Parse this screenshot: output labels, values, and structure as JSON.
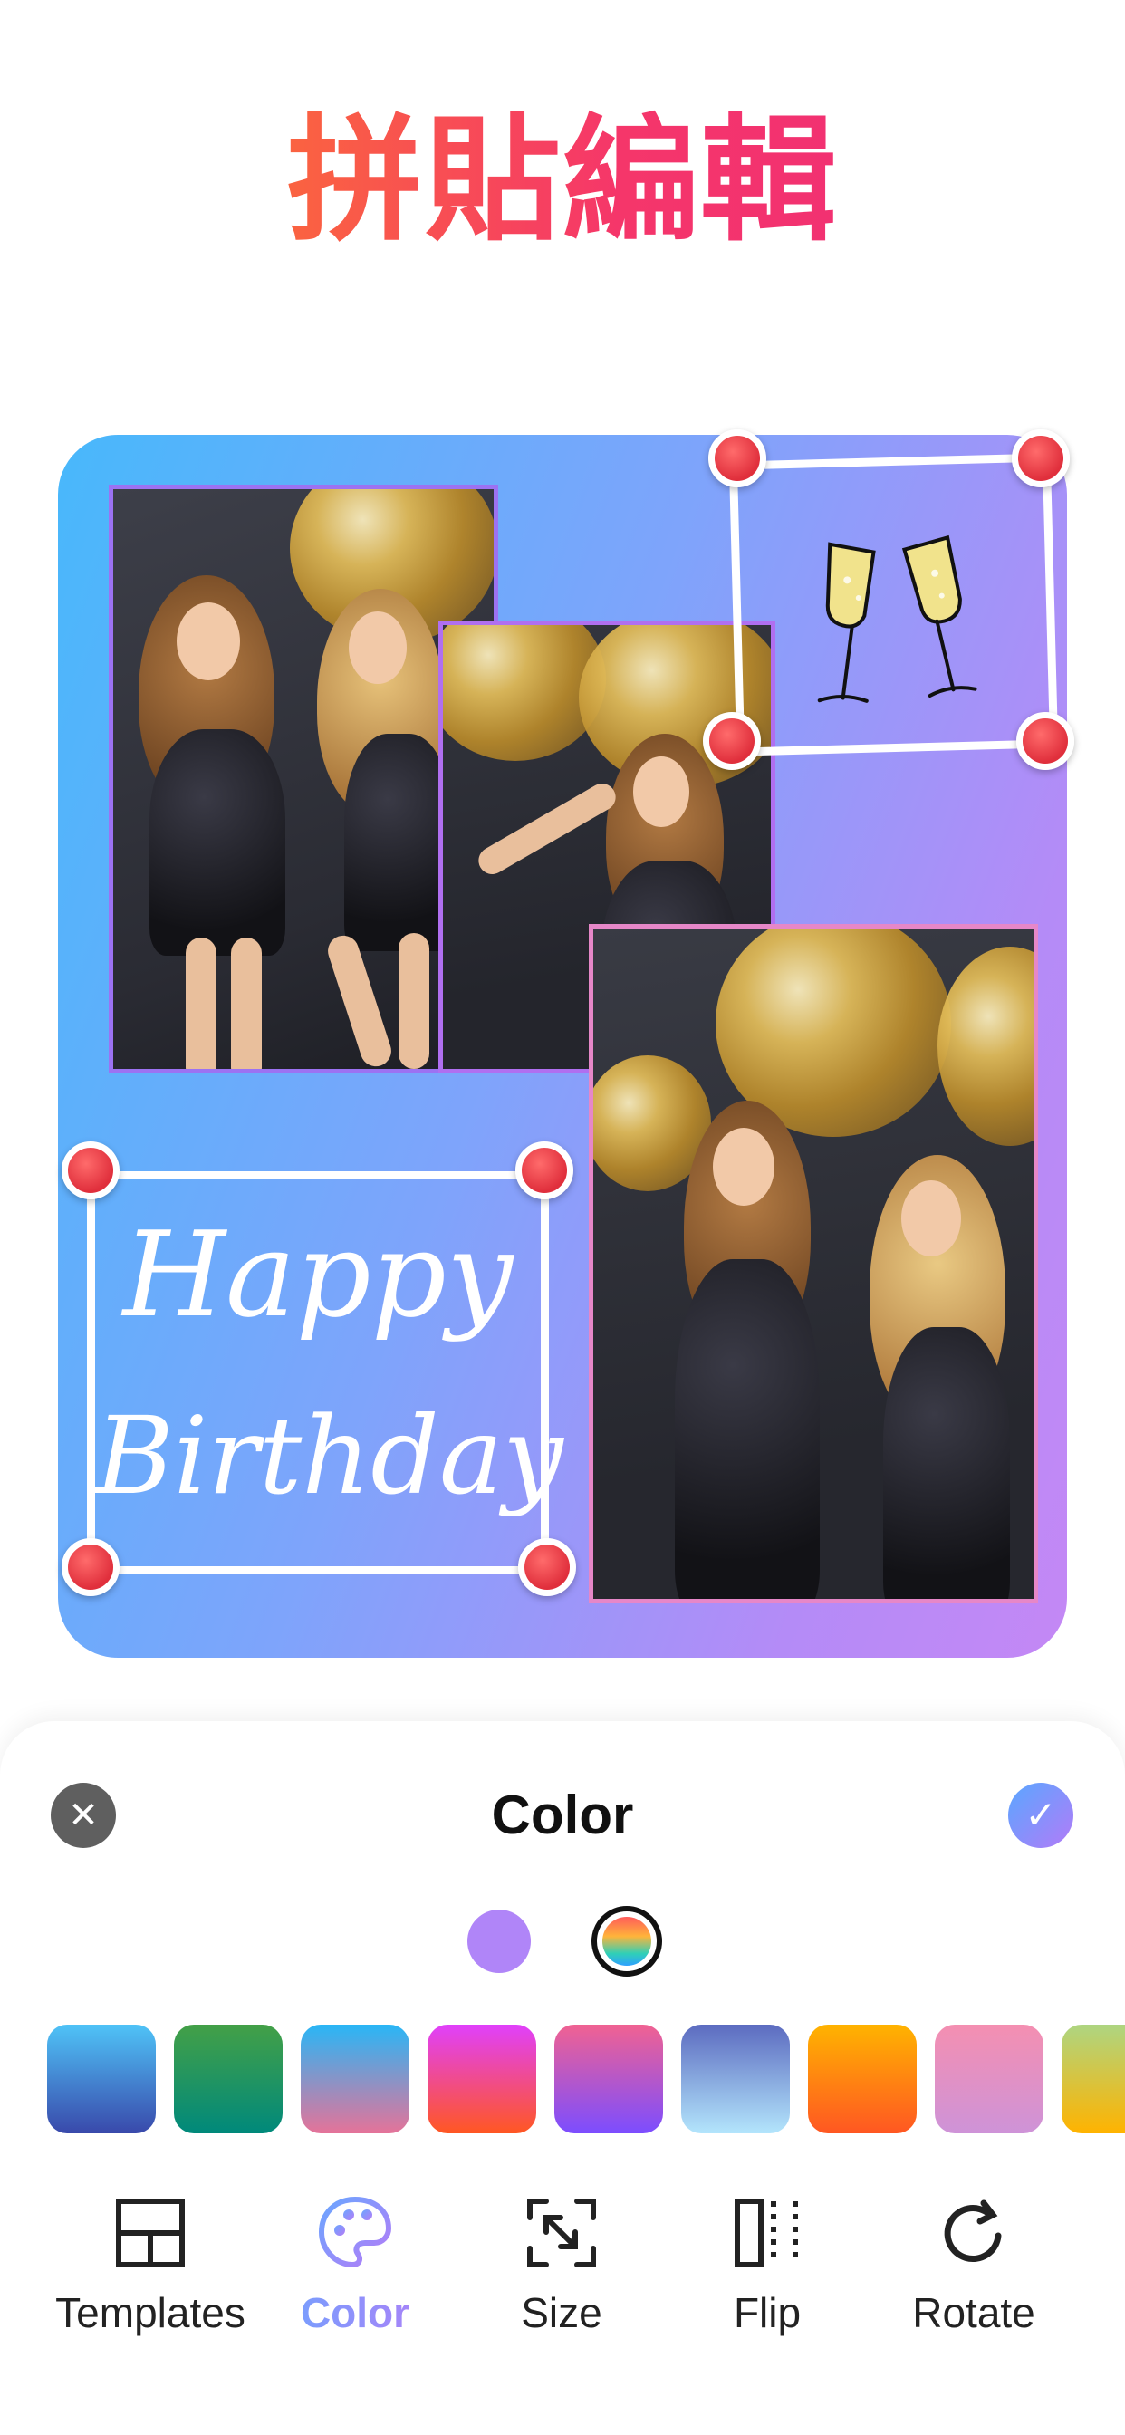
{
  "headline": "拼貼編輯",
  "canvas": {
    "stickers": {
      "birthday_line1": "Happy",
      "birthday_line2": "Birthday"
    }
  },
  "panel": {
    "title": "Color",
    "close_icon": "close-icon",
    "confirm_icon": "check-icon",
    "color_modes": [
      "solid",
      "gradient"
    ],
    "selected_mode": "gradient",
    "swatches": [
      {
        "from": "#4fc3f7",
        "to": "#3949ab"
      },
      {
        "from": "#43a047",
        "to": "#00897b"
      },
      {
        "from": "#29b6f6",
        "to": "#e57399"
      },
      {
        "from": "#e040fb",
        "to": "#ff5722"
      },
      {
        "from": "#f06292",
        "to": "#7c4dff"
      },
      {
        "from": "#5c6bc0",
        "to": "#b3e5fc"
      },
      {
        "from": "#ffb300",
        "to": "#ff5722"
      },
      {
        "from": "#f48fb1",
        "to": "#ce93d8"
      },
      {
        "from": "#aed581",
        "to": "#ffb300"
      }
    ]
  },
  "toolbar": {
    "items": [
      {
        "label": "Templates",
        "icon": "layout-grid-icon",
        "active": false
      },
      {
        "label": "Color",
        "icon": "palette-icon",
        "active": true
      },
      {
        "label": "Size",
        "icon": "resize-icon",
        "active": false
      },
      {
        "label": "Flip",
        "icon": "flip-icon",
        "active": false
      },
      {
        "label": "Rotate",
        "icon": "rotate-icon",
        "active": false
      }
    ]
  },
  "colors": {
    "accent_gradient_start": "#6aa6ff",
    "accent_gradient_end": "#b57cf7",
    "handle": "#e53945"
  }
}
